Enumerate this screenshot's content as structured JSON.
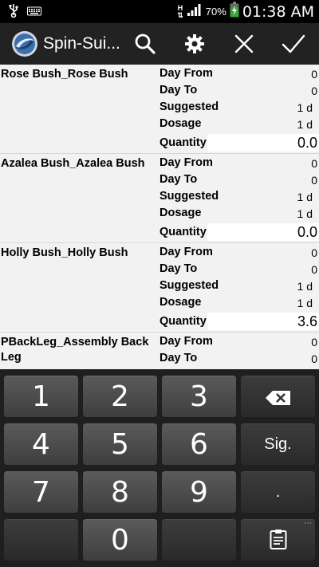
{
  "status_bar": {
    "time": "01:38 AM",
    "battery_percent": "70%",
    "icons": [
      "usb-icon",
      "keyboard-icon",
      "data-h-icon",
      "signal-icon",
      "battery-charging-icon"
    ]
  },
  "action_bar": {
    "title": "Spin-Sui...",
    "actions": [
      "search-icon",
      "settings-icon",
      "close-icon",
      "confirm-icon"
    ]
  },
  "labels": {
    "day_from": "Day From",
    "day_to": "Day To",
    "suggested": "Suggested",
    "dosage": "Dosage",
    "quantity": "Quantity"
  },
  "rows": [
    {
      "product": "Rose Bush_Rose Bush",
      "day_from": "0",
      "day_to": "0",
      "suggested": "1 d",
      "dosage": "1 d",
      "quantity": "0.0"
    },
    {
      "product": "Azalea Bush_Azalea Bush",
      "day_from": "0",
      "day_to": "0",
      "suggested": "1 d",
      "dosage": "1 d",
      "quantity": "0.0"
    },
    {
      "product": "Holly Bush_Holly Bush",
      "day_from": "0",
      "day_to": "0",
      "suggested": "1 d",
      "dosage": "1 d",
      "quantity": "3.6"
    },
    {
      "product": "PBackLeg_Assembly Back Leg",
      "day_from": "0",
      "day_to": "0"
    }
  ],
  "keyboard": {
    "keys": [
      "1",
      "2",
      "3",
      "4",
      "5",
      "6",
      "7",
      "8",
      "9",
      "0"
    ],
    "sign_label": "Sig.",
    "decimal_label": "."
  },
  "colors": {
    "content_bg": "#f2f2f2",
    "action_bar_bg": "#222222",
    "keyboard_bg": "#1f1f1f",
    "key_bg": "#4c4c4c"
  }
}
